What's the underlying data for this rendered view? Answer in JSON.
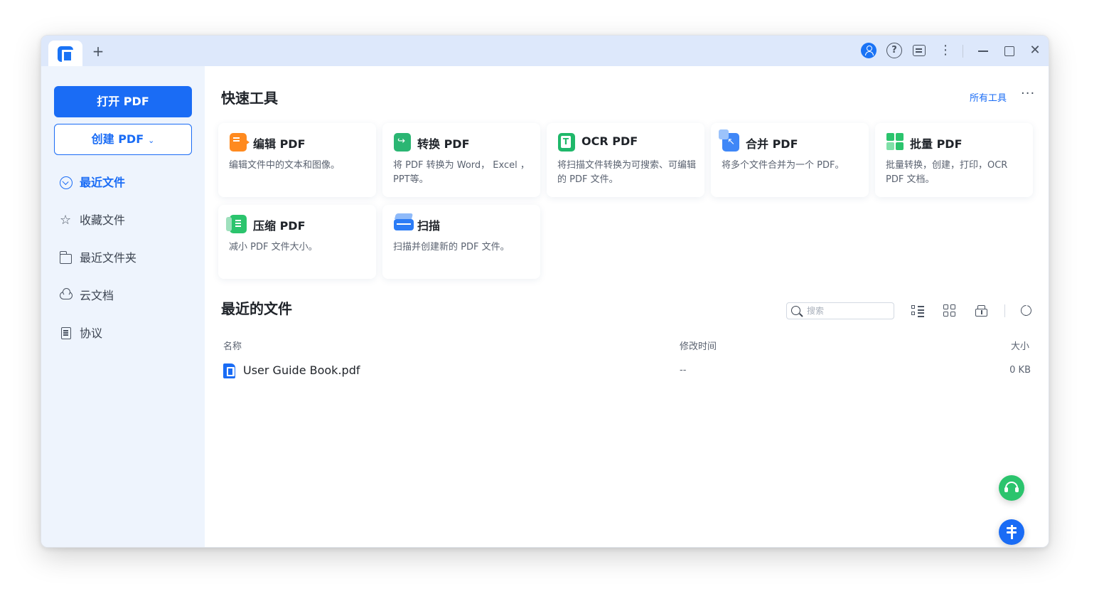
{
  "titlebar": {
    "new_tab": "+",
    "help_glyph": "?",
    "more_glyph": "⋮",
    "close_glyph": "✕",
    "icons": [
      "app-logo",
      "plus-icon",
      "user-icon",
      "help-icon",
      "feedback-icon",
      "more-icon",
      "minimize-icon",
      "maximize-icon",
      "close-icon"
    ]
  },
  "sidebar": {
    "open_pdf": "打开 PDF",
    "create_pdf": "创建 PDF",
    "create_chevron": "⌄",
    "items": [
      {
        "label": "最近文件",
        "icon": "clock-icon",
        "active": true
      },
      {
        "label": "收藏文件",
        "icon": "star-icon",
        "active": false
      },
      {
        "label": "最近文件夹",
        "icon": "folder-icon",
        "active": false
      },
      {
        "label": "云文档",
        "icon": "cloud-icon",
        "active": false
      },
      {
        "label": "协议",
        "icon": "document-icon",
        "active": false
      }
    ],
    "star_glyph": "☆"
  },
  "quick_tools": {
    "title": "快速工具",
    "all_tools": "所有工具",
    "more": "···",
    "cards": [
      {
        "title": "编辑 PDF",
        "desc": "编辑文件中的文本和图像。",
        "icon": "edit-pdf-icon"
      },
      {
        "title": "转换 PDF",
        "desc": "将 PDF 转换为 Word， Excel ，PPT等。",
        "icon": "convert-pdf-icon"
      },
      {
        "title": "OCR PDF",
        "desc": "将扫描文件转换为可搜索、可编辑的 PDF 文件。",
        "icon": "ocr-pdf-icon"
      },
      {
        "title": "合并 PDF",
        "desc": "将多个文件合并为一个 PDF。",
        "icon": "merge-pdf-icon"
      },
      {
        "title": "批量 PDF",
        "desc": "批量转换，创建，打印，OCR PDF 文档。",
        "icon": "batch-pdf-icon"
      },
      {
        "title": "压缩 PDF",
        "desc": "减小 PDF 文件大小。",
        "icon": "compress-pdf-icon"
      },
      {
        "title": "扫描",
        "desc": "扫描并创建新的 PDF 文件。",
        "icon": "scan-icon"
      }
    ]
  },
  "recent": {
    "title": "最近的文件",
    "search_placeholder": "搜索",
    "columns": {
      "name": "名称",
      "modified": "修改时间",
      "size": "大小"
    },
    "files": [
      {
        "name": "User Guide Book.pdf",
        "modified": "--",
        "size": "0 KB"
      }
    ]
  },
  "colors": {
    "accent": "#1a6cf5",
    "sidebar_bg": "#eef4fd",
    "titlebar_bg": "#dde8fb"
  }
}
